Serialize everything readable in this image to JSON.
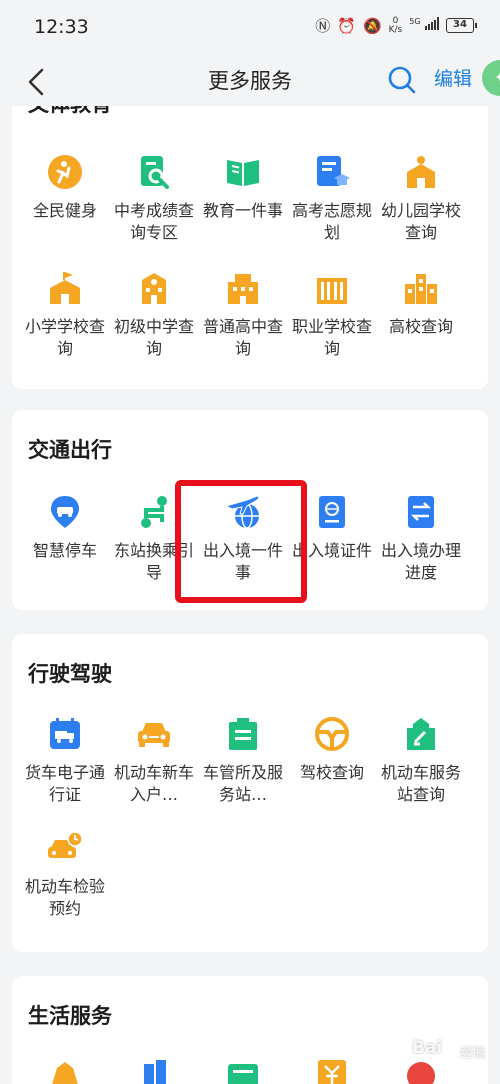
{
  "status_bar": {
    "time": "12:33",
    "net_speed_value": "0",
    "net_speed_unit": "K/s",
    "network_type": "5G",
    "battery": "34"
  },
  "header": {
    "title": "更多服务",
    "edit_label": "编辑"
  },
  "sections": [
    {
      "title": "文体教育",
      "items": [
        {
          "label": "全民健身",
          "icon": "fitness-icon"
        },
        {
          "label": "中考成绩查询专区",
          "icon": "exam-score-search-icon"
        },
        {
          "label": "教育一件事",
          "icon": "education-book-icon"
        },
        {
          "label": "高考志愿规划",
          "icon": "college-plan-icon"
        },
        {
          "label": "幼儿园学校查询",
          "icon": "kindergarten-icon"
        },
        {
          "label": "小学学校查询",
          "icon": "primary-school-icon"
        },
        {
          "label": "初级中学查询",
          "icon": "junior-school-icon"
        },
        {
          "label": "普通高中查询",
          "icon": "high-school-icon"
        },
        {
          "label": "职业学校查询",
          "icon": "vocational-school-icon"
        },
        {
          "label": "高校查询",
          "icon": "university-icon"
        }
      ]
    },
    {
      "title": "交通出行",
      "items": [
        {
          "label": "智慧停车",
          "icon": "parking-location-icon"
        },
        {
          "label": "东站换乘引导",
          "icon": "route-guide-icon"
        },
        {
          "label": "出入境一件事",
          "icon": "airplane-globe-icon"
        },
        {
          "label": "出入境证件",
          "icon": "passport-icon"
        },
        {
          "label": "出入境办理进度",
          "icon": "transfer-progress-icon"
        }
      ]
    },
    {
      "title": "行驶驾驶",
      "items": [
        {
          "label": "货车电子通行证",
          "icon": "truck-pass-icon"
        },
        {
          "label": "机动车新车入户…",
          "icon": "new-car-icon"
        },
        {
          "label": "车管所及服务站…",
          "icon": "vehicle-office-icon"
        },
        {
          "label": "驾校查询",
          "icon": "steering-wheel-icon"
        },
        {
          "label": "机动车服务站查询",
          "icon": "vehicle-service-icon"
        },
        {
          "label": "机动车检验预约",
          "icon": "car-inspection-icon"
        }
      ]
    },
    {
      "title": "生活服务",
      "items": []
    }
  ],
  "watermark": {
    "text": "Bai",
    "sub": "经验"
  },
  "colors": {
    "accent": "#1e7ee8",
    "orange": "#f5a623",
    "green": "#1fbf7f",
    "blue": "#2d7ef0",
    "highlight": "#e8101d"
  }
}
